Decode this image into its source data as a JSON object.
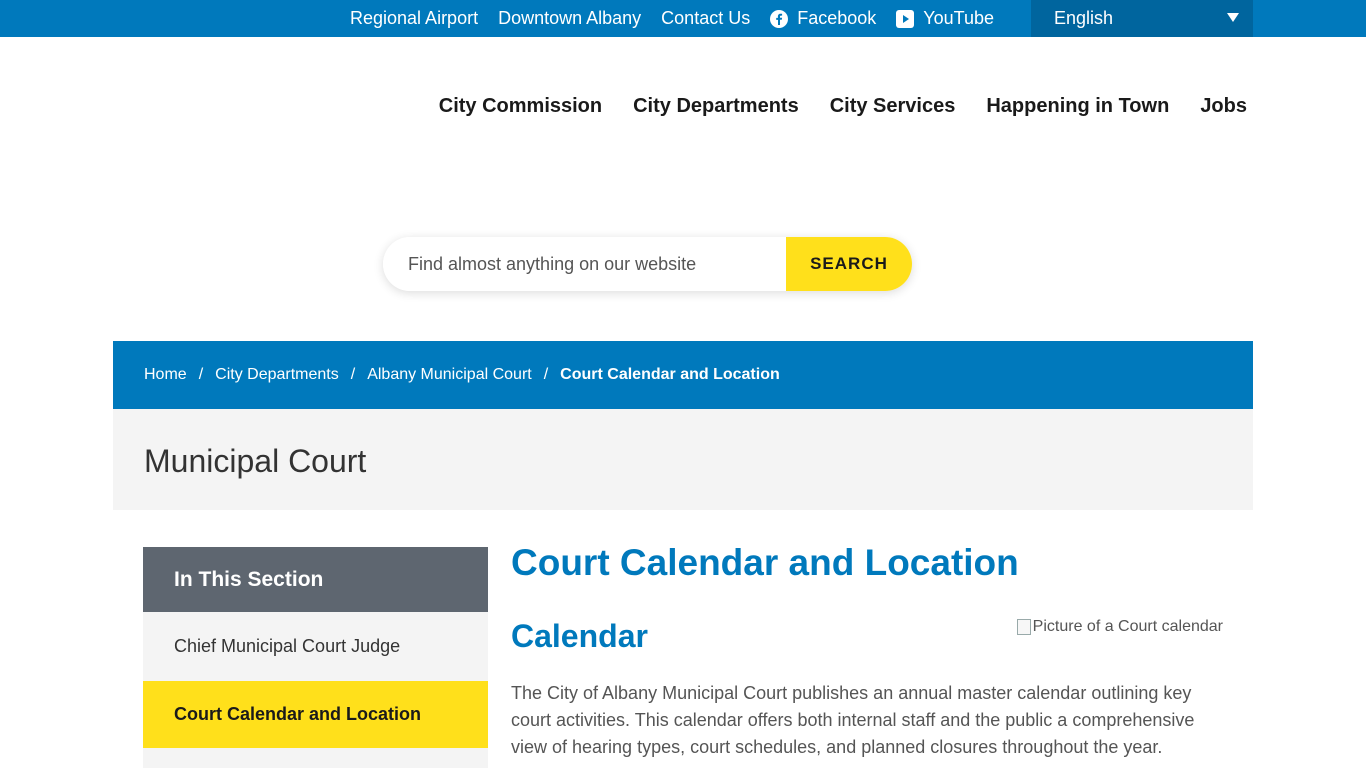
{
  "topbar": {
    "links": [
      {
        "label": "Regional Airport"
      },
      {
        "label": "Downtown Albany"
      },
      {
        "label": "Contact Us"
      },
      {
        "label": "Facebook",
        "icon": "facebook-icon"
      },
      {
        "label": "YouTube",
        "icon": "youtube-icon"
      }
    ],
    "language": "English",
    "color": "#0079bc"
  },
  "mainnav": {
    "items": [
      {
        "label": "City Commission"
      },
      {
        "label": "City Departments"
      },
      {
        "label": "City Services"
      },
      {
        "label": "Happening in Town"
      },
      {
        "label": "Jobs"
      }
    ]
  },
  "search": {
    "placeholder": "Find almost anything on our website",
    "button_label": "SEARCH",
    "button_color": "#ffe01b"
  },
  "breadcrumb": {
    "items": [
      {
        "label": "Home"
      },
      {
        "label": "City Departments"
      },
      {
        "label": "Albany Municipal Court"
      }
    ],
    "separator": "/",
    "current": "Court Calendar and Location"
  },
  "banner": {
    "title": "Municipal Court"
  },
  "sidebar": {
    "heading": "In This Section",
    "items": [
      {
        "label": "Chief Municipal Court Judge",
        "active": false
      },
      {
        "label": "Court Calendar and Location",
        "active": true
      }
    ]
  },
  "content": {
    "title": "Court Calendar and Location",
    "subtitle": "Calendar",
    "image_alt": "Picture of a Court calendar",
    "paragraph": "The City of Albany Municipal Court publishes an annual master calendar outlining key court activities. This calendar offers both internal staff and the public a comprehensive view of hearing types, court schedules, and planned closures throughout the year."
  }
}
